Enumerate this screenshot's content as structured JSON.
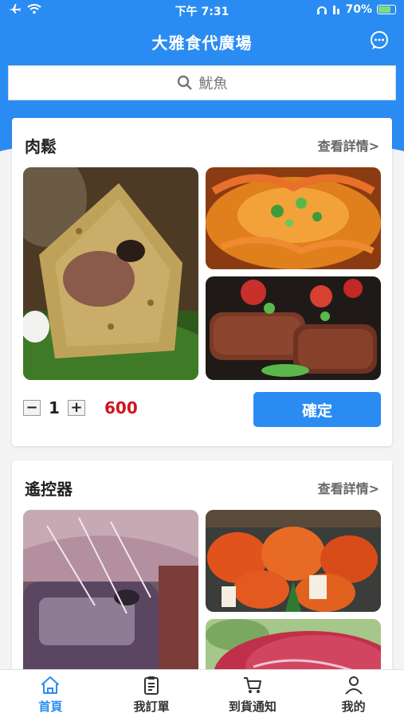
{
  "status": {
    "time": "下午 7:31",
    "battery": "70%"
  },
  "header": {
    "title": "大雅食代廣場"
  },
  "search": {
    "placeholder": "魷魚"
  },
  "cards": [
    {
      "title": "肉鬆",
      "more": "查看詳情>",
      "quantity": "1",
      "price": "600",
      "confirm": "確定"
    },
    {
      "title": "遙控器",
      "more": "查看詳情>"
    }
  ],
  "tabs": [
    {
      "label": "首頁",
      "icon": "home-icon",
      "active": true
    },
    {
      "label": "我訂單",
      "icon": "clipboard-icon",
      "active": false
    },
    {
      "label": "到貨通知",
      "icon": "cart-icon",
      "active": false
    },
    {
      "label": "我的",
      "icon": "user-icon",
      "active": false
    }
  ],
  "colors": {
    "accent": "#2a8cf2",
    "price": "#d0151c"
  }
}
